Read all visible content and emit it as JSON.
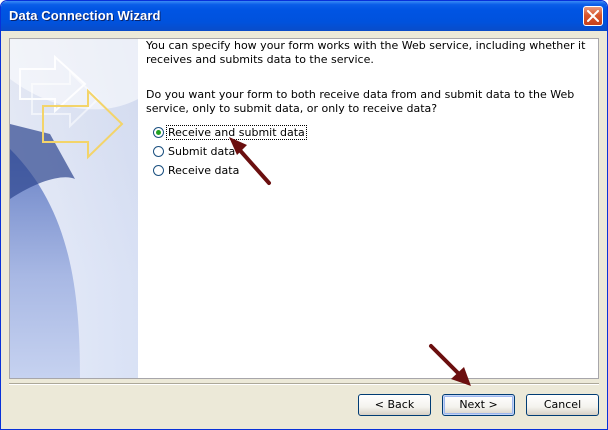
{
  "window": {
    "title": "Data Connection Wizard"
  },
  "intro": {
    "text": "You can specify how your form works with the Web service, including whether it receives and submits data to the service."
  },
  "question": {
    "text": "Do you want your form to both receive data from and submit data to the Web service, only to submit data, or only to receive data?"
  },
  "options": [
    {
      "label": "Receive and submit data",
      "selected": true
    },
    {
      "label": "Submit data",
      "selected": false
    },
    {
      "label": "Receive data",
      "selected": false
    }
  ],
  "buttons": {
    "back": "< Back",
    "next": "Next >",
    "cancel": "Cancel"
  },
  "colors": {
    "titlebar": "#0054E3",
    "dialog_bg": "#ECE9D8",
    "annotation_arrow": "#6B0F0F",
    "radio_selected": "#21A121"
  }
}
